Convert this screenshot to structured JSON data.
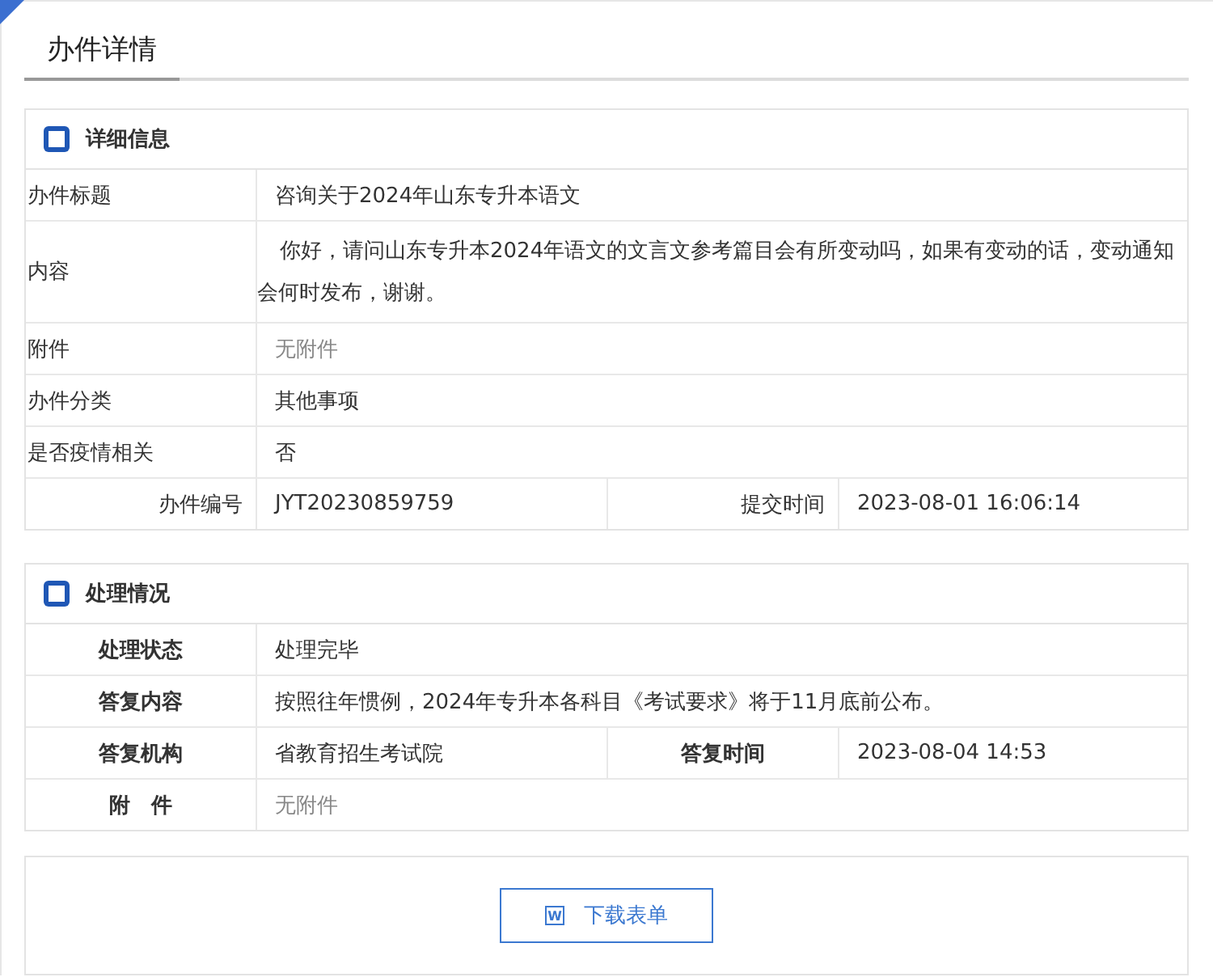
{
  "tab": {
    "label": "办件详情",
    "selected": true
  },
  "details": {
    "title": "详细信息",
    "rows": [
      {
        "kind": "single",
        "label": "办件标题",
        "value": "咨询关于2024年山东专升本语文"
      },
      {
        "kind": "paragraph",
        "label": "内容",
        "value": "你好，请问山东专升本2024年语文的文言文参考篇目会有所变动吗，如果有变动的话，变动通知会何时发布，谢谢。"
      },
      {
        "kind": "muted",
        "label": "附件",
        "value": "无附件"
      },
      {
        "kind": "single",
        "label": "办件分类",
        "value": "其他事项"
      },
      {
        "kind": "single",
        "label": "是否疫情相关",
        "value": "否"
      },
      {
        "kind": "pair",
        "label": "办件编号",
        "value": "JYT20230859759",
        "label2": "提交时间",
        "value2": "2023-08-01 16:06:14"
      }
    ]
  },
  "handling": {
    "title": "处理情况",
    "rows": [
      {
        "kind": "single",
        "label": "处理状态",
        "value": "处理完毕"
      },
      {
        "kind": "single",
        "label": "答复内容",
        "value": "按照往年惯例，2024年专升本各科目《考试要求》将于11月底前公布。"
      },
      {
        "kind": "pair",
        "label": "答复机构",
        "value": "省教育招生考试院",
        "label2": "答复时间",
        "value2": "2023-08-04 14:53"
      },
      {
        "kind": "muted",
        "label": "附　件",
        "value": "无附件"
      }
    ]
  },
  "download": {
    "icon_letter": "W",
    "label": "下载表单"
  }
}
